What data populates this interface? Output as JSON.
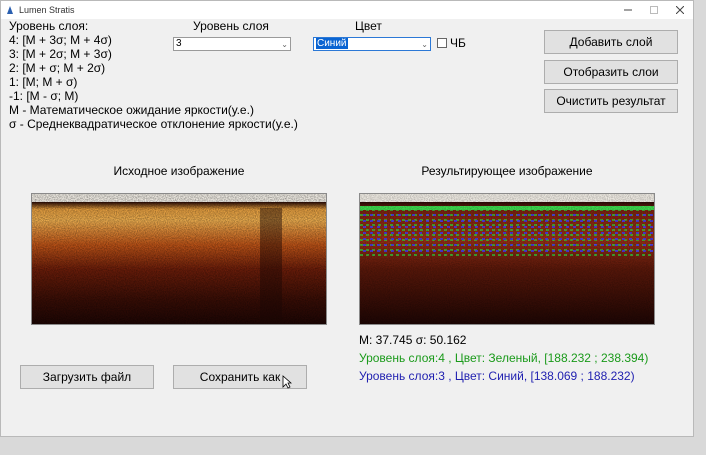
{
  "window": {
    "title": "Lumen Stratis"
  },
  "legend": {
    "heading": "Уровень слоя:",
    "levels": [
      "4: [M + 3σ; M + 4σ)",
      "3: [M + 2σ; M + 3σ)",
      "2: [M + σ; M + 2σ)",
      "1: [M; M + σ)",
      "-1: [M - σ; M)"
    ],
    "def_m": "M - Математическое ожидание яркости(у.е.)",
    "def_sigma": "σ - Среднеквадратическое отклонение яркости(у.е.)"
  },
  "controls": {
    "level_label": "Уровень слоя",
    "level_value": "3",
    "color_label": "Цвет",
    "color_value": "Синий",
    "bw_label": "ЧБ",
    "bw_checked": false
  },
  "buttons": {
    "add_layer": "Добавить слой",
    "show_layers": "Отобразить слои",
    "clear_result": "Очистить результат",
    "load_file": "Загрузить файл",
    "save_as": "Сохранить как"
  },
  "images": {
    "source_title": "Исходное изображение",
    "result_title": "Результирующее изображение"
  },
  "stats": {
    "summary": "M: 37.745 σ: 50.162",
    "layer_green": "Уровень слоя:4 , Цвет: Зеленый, [188.232 ; 238.394)",
    "layer_blue": "Уровень слоя:3 , Цвет: Синий, [138.069 ; 188.232)",
    "green_color": "#1a9a1a",
    "blue_color": "#1f1fb0"
  }
}
